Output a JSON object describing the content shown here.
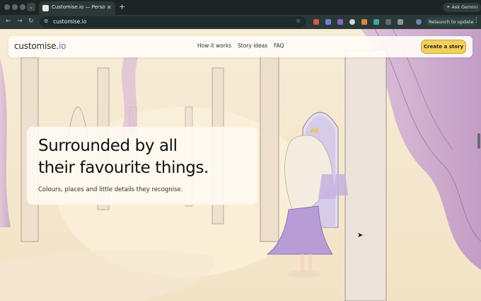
{
  "browser": {
    "tab_title": "Customise.io — Personalised",
    "tab_close": "✕",
    "new_tab": "+",
    "tab_menu": "⌄",
    "ask_gemini": "Ask Gemini",
    "url": "customise.io",
    "relaunch": "Relaunch to update",
    "nav": {
      "back": "←",
      "forward": "→",
      "reload": "↻"
    },
    "kebab": "⋮",
    "star": "☆"
  },
  "site": {
    "logo_main": "customise.",
    "logo_io": "io",
    "nav_links": [
      "How it works",
      "Story ideas",
      "FAQ"
    ],
    "cta": "Create a story"
  },
  "hero": {
    "title_line1": "Surrounded by all",
    "title_line2": "their favourite things.",
    "subtitle": "Colours, places and little details they recognise."
  },
  "colors": {
    "accent": "#f4cf5a",
    "logo_accent": "#7a63b8",
    "chrome_dark": "#1d2424"
  }
}
